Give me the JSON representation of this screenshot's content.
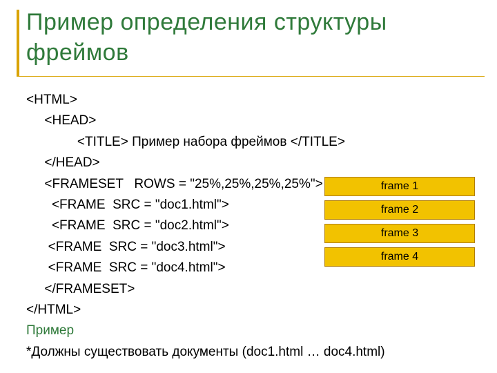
{
  "title": "Пример определения структуры фреймов",
  "code": {
    "l1": "<HTML>",
    "l2": "     <HEAD>",
    "l3": "              <TITLE> Пример набора фреймов </TITLE>",
    "l4": "     </HEAD>",
    "l5": "     <FRAMESET   ROWS = \"25%,25%,25%,25%\">",
    "l6": "       <FRAME  SRC = \"doc1.html\">",
    "l7": "       <FRAME  SRC = \"doc2.html\">",
    "l8": "      <FRAME  SRC = \"doc3.html\">",
    "l9": "      <FRAME  SRC = \"doc4.html\">",
    "l10": "     </FRAMESET>",
    "l11": "</HTML>"
  },
  "example_label": "Пример",
  "note": "*Должны существовать документы (doc1.html … doc4.html)",
  "frames": {
    "f1": "frame 1",
    "f2": "frame 2",
    "f3": "frame 3",
    "f4": "frame 4"
  }
}
